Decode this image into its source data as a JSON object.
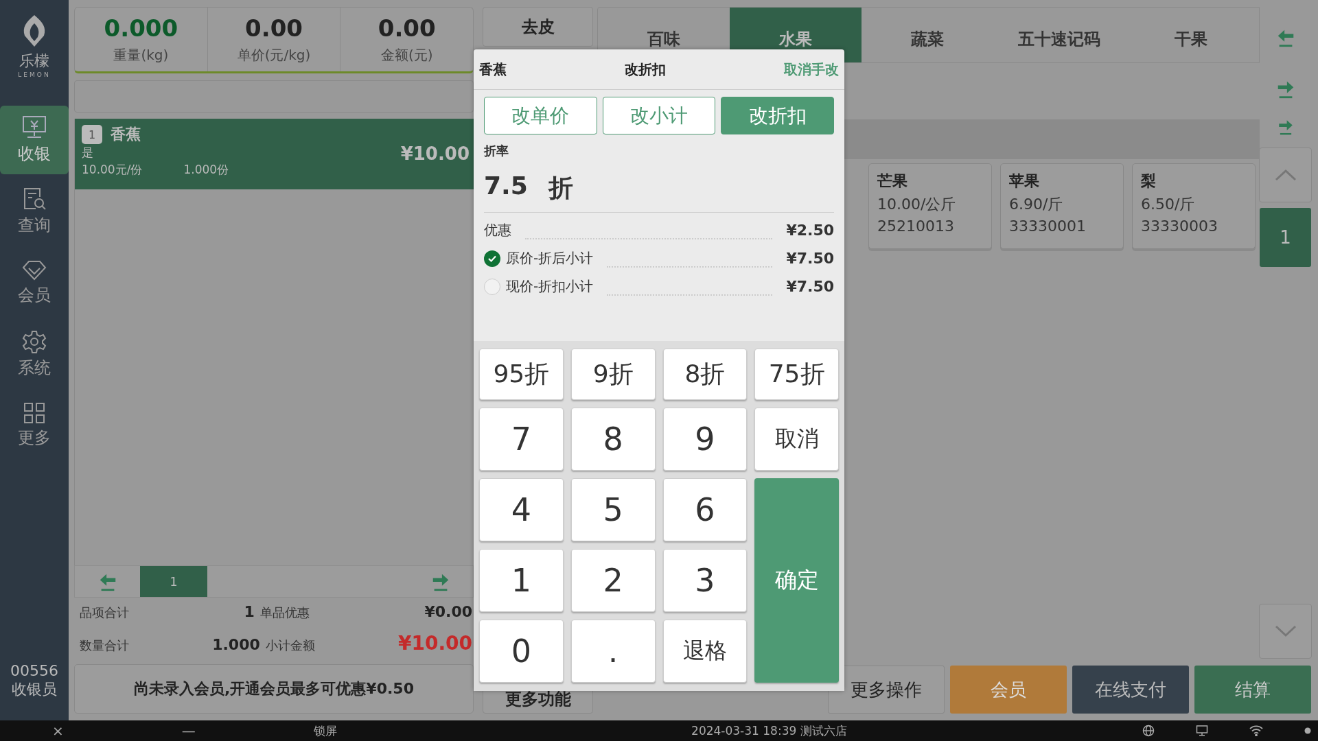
{
  "sidebar": {
    "logo": {
      "name": "乐檬",
      "sub": "LEMON"
    },
    "items": [
      {
        "label": "收银",
        "kind": "cashier",
        "selected": true
      },
      {
        "label": "查询",
        "kind": "query",
        "selected": false
      },
      {
        "label": "会员",
        "kind": "member",
        "selected": false
      },
      {
        "label": "系统",
        "kind": "settings",
        "selected": false
      },
      {
        "label": "更多",
        "kind": "more",
        "selected": false
      }
    ],
    "footer": {
      "code": "00556",
      "role": "收银员"
    }
  },
  "scale": [
    {
      "value": "0.000",
      "label": "重量(kg)",
      "kind": "weight"
    },
    {
      "value": "0.00",
      "label": "单价(元/kg)",
      "kind": "price"
    },
    {
      "value": "0.00",
      "label": "金额(元)",
      "kind": "price"
    }
  ],
  "cart": {
    "items": [
      {
        "index": "1",
        "name": "香蕉",
        "note": "是",
        "unit_price": "10.00元/份",
        "quantity": "1.000份",
        "amount": "¥10.00",
        "selected": true
      }
    ],
    "page": "1"
  },
  "summary": [
    [
      {
        "label": "品项合计",
        "value": "1",
        "kind": "plain"
      },
      {
        "label": "单品优惠",
        "value": "¥0.00",
        "kind": "plain"
      }
    ],
    [
      {
        "label": "数量合计",
        "value": "1.000",
        "kind": "plain"
      },
      {
        "label": "小计金额",
        "value": "¥10.00",
        "kind": "total"
      }
    ]
  ],
  "member_banner": "尚未录入会员,开通会员最多可优惠¥0.50",
  "tools": {
    "tare": "去皮",
    "more_functions": "更多功能"
  },
  "categories": [
    {
      "label": "百味",
      "selected": false
    },
    {
      "label": "水果",
      "selected": true
    },
    {
      "label": "蔬菜",
      "selected": false
    },
    {
      "label": "五十速记码",
      "selected": false
    },
    {
      "label": "干果",
      "selected": false
    }
  ],
  "products": [
    {
      "name": "芒果",
      "price": "10.00/公斤",
      "code": "25210013"
    },
    {
      "name": "苹果",
      "price": "6.90/斤",
      "code": "33330001"
    },
    {
      "name": "梨",
      "price": "6.50/斤",
      "code": "33330003"
    }
  ],
  "product_page": "1",
  "actions": [
    {
      "label": "更多操作",
      "kind": "plain"
    },
    {
      "label": "会员",
      "kind": "member"
    },
    {
      "label": "在线支付",
      "kind": "online"
    },
    {
      "label": "结算",
      "kind": "checkout"
    }
  ],
  "dialog": {
    "product": "香蕉",
    "title": "改折扣",
    "cancel_link": "取消手改",
    "modes": [
      {
        "label": "改单价",
        "selected": false
      },
      {
        "label": "改小计",
        "selected": false
      },
      {
        "label": "改折扣",
        "selected": true
      }
    ],
    "rate_label": "折率",
    "rate_value": "7.5",
    "rate_unit": "折",
    "rows": [
      {
        "label": "优惠",
        "value": "¥2.50",
        "kind": "plain"
      },
      {
        "label": "原价-折后小计",
        "value": "¥7.50",
        "kind": "option",
        "selected": true
      },
      {
        "label": "现价-折扣小计",
        "value": "¥7.50",
        "kind": "option",
        "selected": false
      }
    ],
    "presets": [
      "95折",
      "9折",
      "8折",
      "75折"
    ],
    "keys": [
      {
        "label": "7",
        "kind": "digit"
      },
      {
        "label": "8",
        "kind": "digit"
      },
      {
        "label": "9",
        "kind": "digit"
      },
      {
        "label": "取消",
        "kind": "action"
      },
      {
        "label": "4",
        "kind": "digit"
      },
      {
        "label": "5",
        "kind": "digit"
      },
      {
        "label": "6",
        "kind": "digit"
      },
      {
        "label": "1",
        "kind": "digit"
      },
      {
        "label": "2",
        "kind": "digit"
      },
      {
        "label": "3",
        "kind": "digit"
      },
      {
        "label": "确定",
        "kind": "confirm"
      },
      {
        "label": "0",
        "kind": "digit"
      },
      {
        "label": ".",
        "kind": "digit"
      },
      {
        "label": "退格",
        "kind": "action"
      }
    ]
  },
  "taskbar": {
    "close": "×",
    "minimize": "—",
    "lock": "锁屏",
    "status": "2024-03-31 18:39 测试六店"
  }
}
